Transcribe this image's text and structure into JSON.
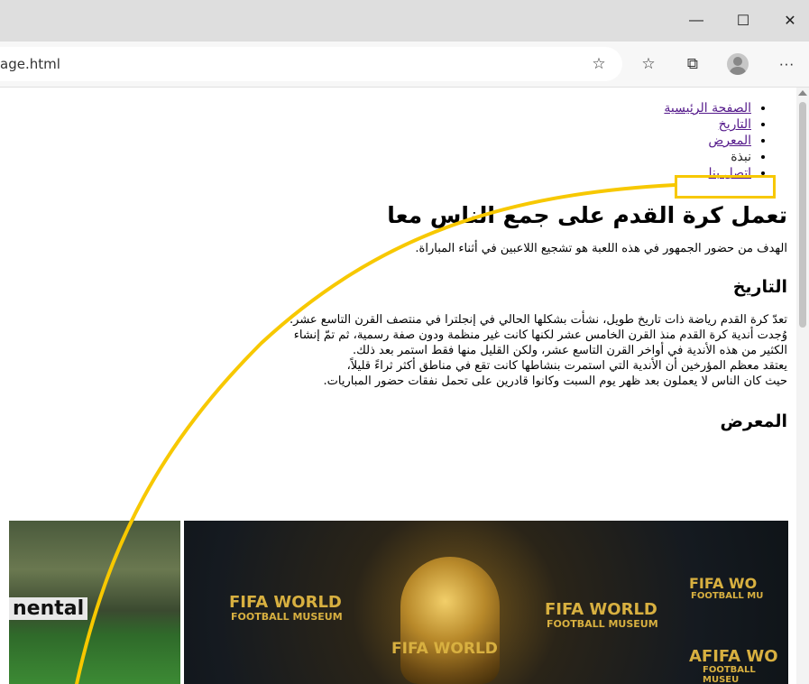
{
  "window": {
    "minimize_glyph": "—",
    "maximize_glyph": "☐",
    "close_glyph": "✕"
  },
  "toolbar": {
    "address": "age.html",
    "icons": [
      "add-favorite-icon",
      "favorites-icon",
      "collections-icon",
      "profile-icon",
      "more-icon"
    ],
    "more_glyph": "···"
  },
  "nav": {
    "items": [
      {
        "label": "الصفحة الرئيسية",
        "link": true
      },
      {
        "label": "التاريخ",
        "link": true
      },
      {
        "label": "المعرض",
        "link": true
      },
      {
        "label": "نبذة",
        "link": false
      },
      {
        "label": "اتصل بنا",
        "link": true
      }
    ]
  },
  "main": {
    "heading": "تعمل كرة القدم على جمع الناس معا",
    "intro": "الهدف من حضور الجمهور في هذه اللعبة هو تشجيع اللاعبين في أثناء المباراة.",
    "history_heading": "التاريخ",
    "history_lines": [
      "تعدّ كرة القدم رياضة ذات تاريخ طويل، نشأت بشكلها الحالي في إنجلترا في منتصف القرن التاسع عشر.",
      "وُجدت أندية كرة القدم منذ القرن الخامس عشر لكنها كانت غير منظمة ودون صفة رسمية، ثم تمّ إنشاء",
      "الكثير من هذه الأندية في أواخر القرن التاسع عشر، ولكن القليل منها فقط استمر بعد ذلك.",
      "يعتقد معظم المؤرخين أن الأندية التي استمرت بنشاطها كانت تقع في مناطق أكثر ثراءً قليلاً،",
      "حيث كان الناس لا يعملون بعد ظهر يوم السبت وكانوا قادرين على تحمل نفقات حضور المباريات."
    ],
    "gallery_heading": "المعرض"
  },
  "gallery": {
    "img1_text": "nental",
    "img2_texts": [
      "FIFA WORLD",
      "FOOTBALL MUSEUM",
      "FIFA WORLD",
      "FOOTBALL MUSEUM",
      "FIFA WO",
      "FOOTBALL MU",
      "FIFA WORLD",
      "AFIFA WO",
      "FOOTBALL MUSEU"
    ]
  },
  "colors": {
    "highlight": "#f7c800",
    "link": "#551a8b"
  }
}
